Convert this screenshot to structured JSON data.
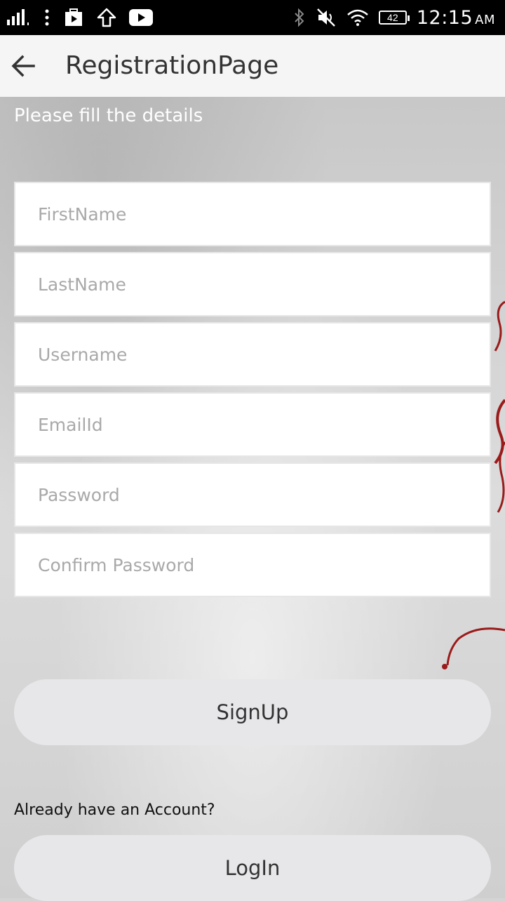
{
  "status_bar": {
    "time": "12:15",
    "ampm": "AM",
    "battery_level": "42"
  },
  "app_bar": {
    "title": "RegistrationPage"
  },
  "form": {
    "subtitle": "Please fill the details",
    "fields": [
      {
        "placeholder": "FirstName",
        "value": ""
      },
      {
        "placeholder": "LastName",
        "value": ""
      },
      {
        "placeholder": "Username",
        "value": ""
      },
      {
        "placeholder": "EmailId",
        "value": ""
      },
      {
        "placeholder": "Password",
        "value": ""
      },
      {
        "placeholder": "Confirm Password",
        "value": ""
      }
    ],
    "signup_label": "SignUp",
    "already_text": "Already have an Account?",
    "login_label": "LogIn"
  },
  "colors": {
    "status_bar_bg": "#000000",
    "app_bar_bg": "#f5f5f5",
    "button_bg": "#e7e7ea",
    "decor_red": "#9b1b1b"
  }
}
